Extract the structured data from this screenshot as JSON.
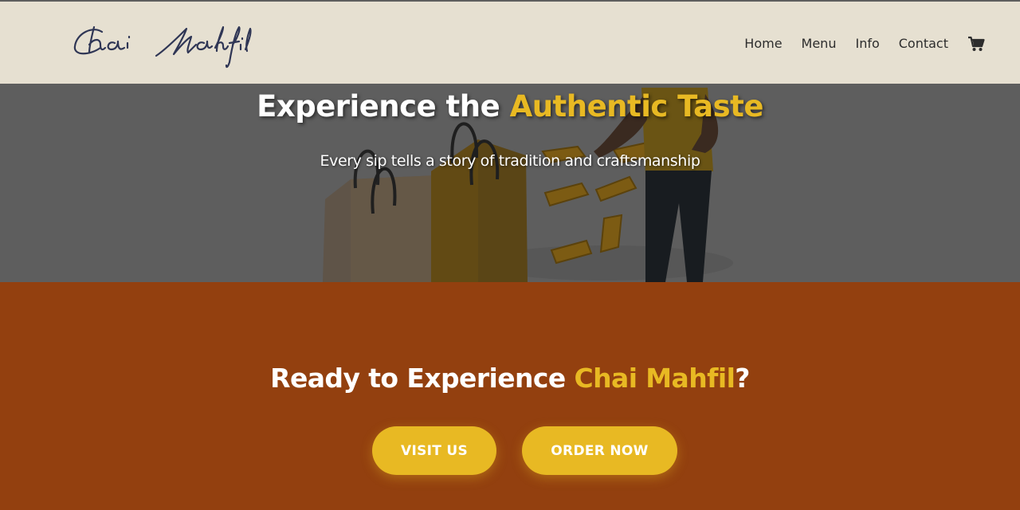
{
  "brand": {
    "logo_text": "Chai Mahfil"
  },
  "nav": {
    "items": [
      {
        "label": "Home"
      },
      {
        "label": "Menu"
      },
      {
        "label": "Info"
      },
      {
        "label": "Contact"
      }
    ],
    "cart_icon": "shopping-cart-icon"
  },
  "hero": {
    "title_main": "Experience the ",
    "title_accent": "Authentic Taste",
    "subtitle": "Every sip tells a story of tradition and craftsmanship"
  },
  "cta": {
    "title_main": "Ready to Experience ",
    "title_accent": "Chai Mahfil",
    "title_end": "?",
    "visit_label": "VISIT US",
    "order_label": "ORDER NOW"
  },
  "colors": {
    "accent": "#e8b923",
    "cta_background": "#93400f",
    "header_background": "#e6e0d1",
    "hero_overlay": "#5e5e5e"
  }
}
